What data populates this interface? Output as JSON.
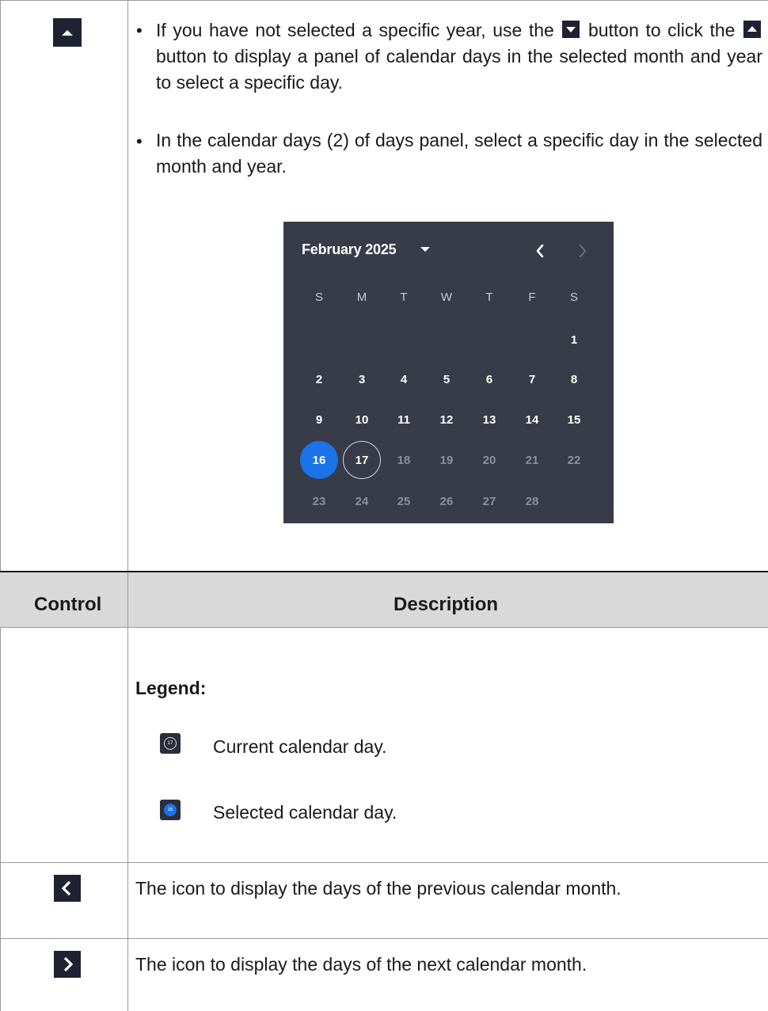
{
  "top_row": {
    "bullets": [
      {
        "part1": "If you have not selected a specific year, use the",
        "icon1": "caret-down-icon",
        "part2": "button to click the",
        "icon2": "caret-up-icon",
        "part3": "button to display a panel of calendar days in the selected month and year to select a specific day."
      },
      {
        "text": "In the calendar days (2) of days panel, select a specific day in the selected month and year."
      }
    ],
    "control_icon": "caret-up-icon"
  },
  "calendar": {
    "title": "February 2025",
    "weekdays": [
      "S",
      "M",
      "T",
      "W",
      "T",
      "F",
      "S"
    ],
    "weeks": [
      [
        "",
        "",
        "",
        "",
        "",
        "",
        "1"
      ],
      [
        "2",
        "3",
        "4",
        "5",
        "6",
        "7",
        "8"
      ],
      [
        "9",
        "10",
        "11",
        "12",
        "13",
        "14",
        "15"
      ],
      [
        "16",
        "17",
        "18",
        "19",
        "20",
        "21",
        "22"
      ],
      [
        "23",
        "24",
        "25",
        "26",
        "27",
        "28",
        ""
      ]
    ],
    "selected_day": "16",
    "current_day": "17",
    "colors": {
      "panel": "#383b48",
      "selected": "#1a73e8"
    }
  },
  "table_header": {
    "control": "Control",
    "description": "Description"
  },
  "legend": {
    "title": "Legend:",
    "items": [
      {
        "icon": "current-day-icon",
        "text": "Current calendar day.",
        "badge": "17"
      },
      {
        "icon": "selected-day-icon",
        "text": "Selected calendar day.",
        "badge": "16"
      }
    ]
  },
  "rows": [
    {
      "icon": "chevron-left-icon",
      "text": "The icon to display the days of the previous calendar month."
    },
    {
      "icon": "chevron-right-icon",
      "text": "The icon to display the days of the next calendar month."
    }
  ]
}
